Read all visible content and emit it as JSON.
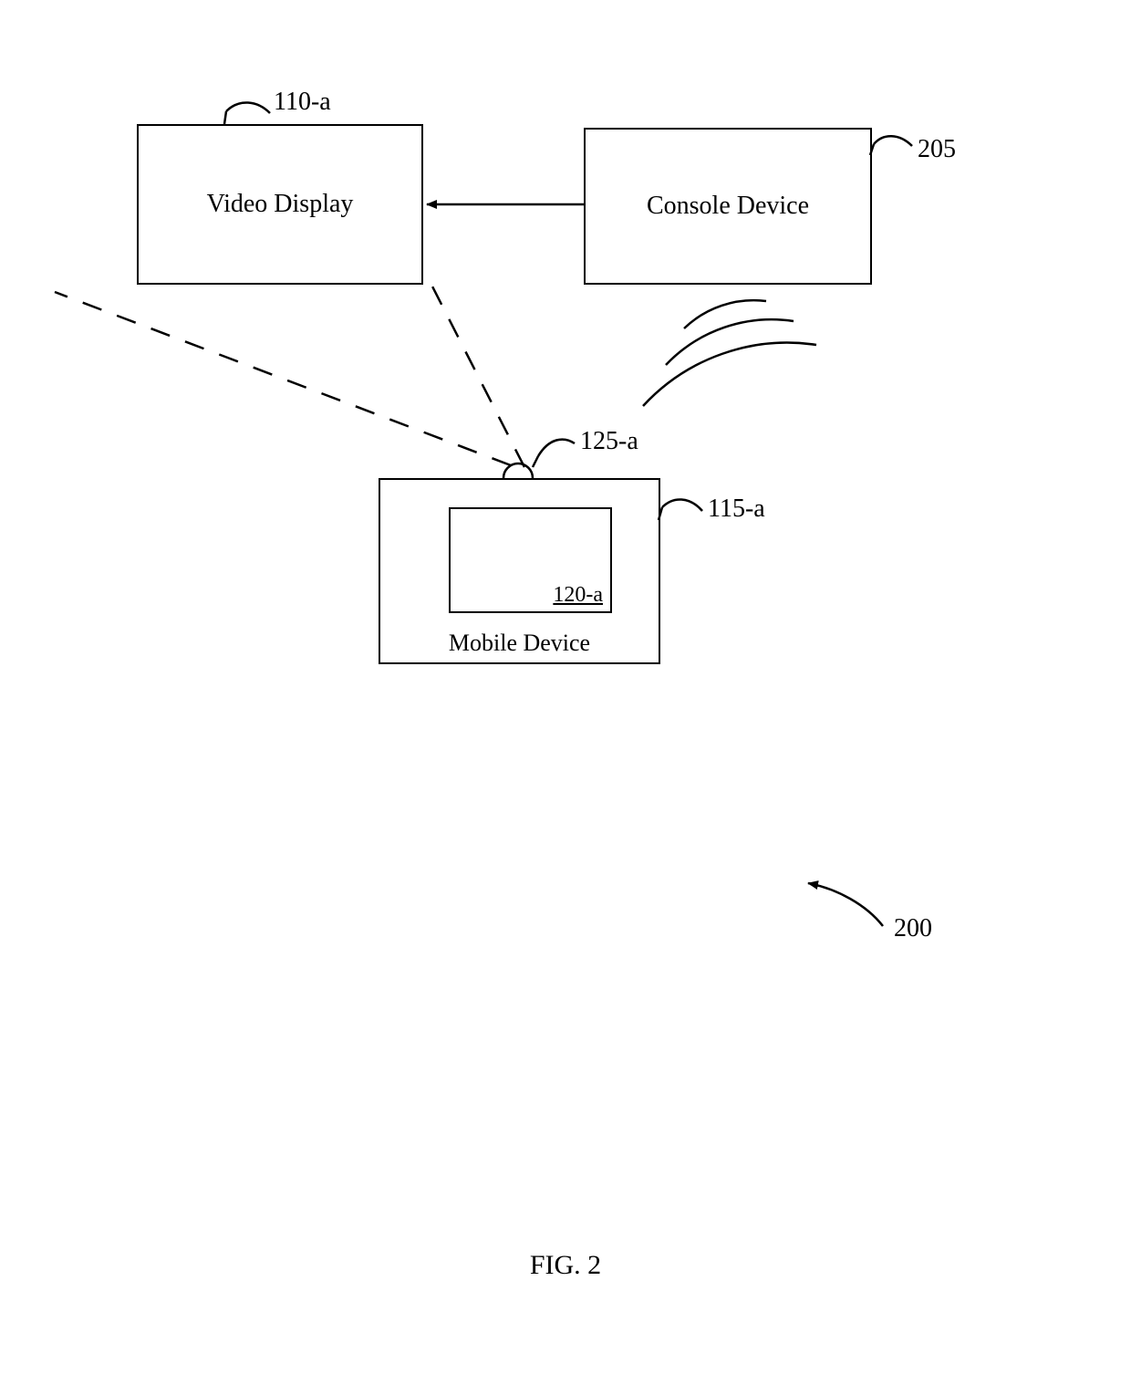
{
  "boxes": {
    "video_display": {
      "label": "Video Display",
      "ref": "110-a"
    },
    "console_device": {
      "label": "Console Device",
      "ref": "205"
    },
    "mobile_device": {
      "label": "Mobile Device",
      "ref_box": "115-a",
      "ref_inner": "120-a",
      "ref_camera": "125-a"
    }
  },
  "figure": {
    "overall_ref": "200",
    "caption": "FIG. 2"
  }
}
